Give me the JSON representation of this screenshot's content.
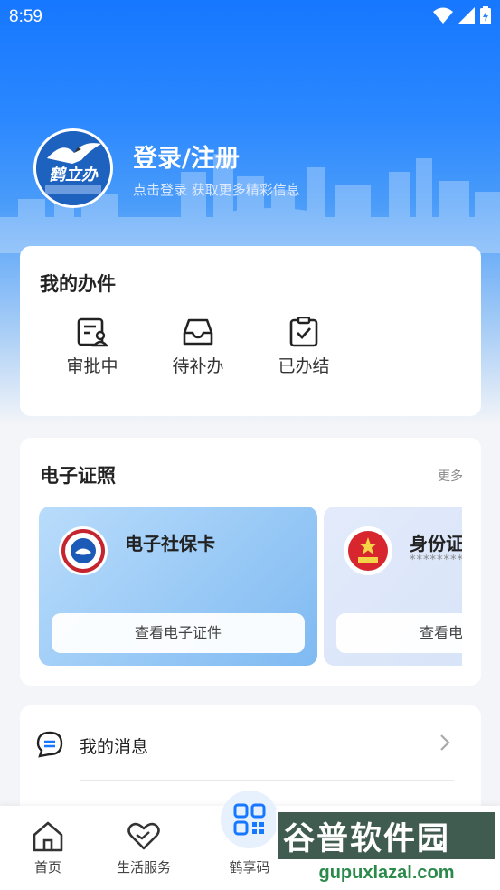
{
  "status_bar": {
    "time": "8:59",
    "icons": [
      "wifi-icon",
      "signal-icon",
      "battery-icon"
    ]
  },
  "profile": {
    "avatar_text": "鹤立办",
    "login_title": "登录/注册",
    "login_subtitle": "点击登录 获取更多精彩信息"
  },
  "my_tasks": {
    "title": "我的办件",
    "items": [
      {
        "label": "审批中",
        "icon": "approval-doc-icon"
      },
      {
        "label": "待补办",
        "icon": "inbox-tray-icon"
      },
      {
        "label": "已办结",
        "icon": "clipboard-check-icon"
      }
    ]
  },
  "certificates": {
    "title": "电子证照",
    "more": "更多",
    "cards": [
      {
        "name": "电子社保卡",
        "masked": "",
        "button": "查看电子证件",
        "icon": "social-security-emblem-icon"
      },
      {
        "name": "身份证",
        "masked": "********",
        "button": "查看电子证件",
        "icon": "national-emblem-icon"
      }
    ]
  },
  "messages": {
    "label": "我的消息",
    "icon": "message-bubble-icon"
  },
  "tab_bar": {
    "tabs": [
      {
        "label": "首页",
        "icon": "home-icon"
      },
      {
        "label": "生活服务",
        "icon": "heart-hands-icon"
      },
      {
        "label": "鹤享码",
        "icon": "qr-code-icon"
      },
      {
        "label": "",
        "icon": ""
      },
      {
        "label": "",
        "icon": ""
      }
    ]
  },
  "watermark": {
    "text": "谷普软件园",
    "url": "gupuxlazal.com"
  },
  "colors": {
    "primary": "#1677ff",
    "card_bg": "#ffffff",
    "page_bg": "#f4f5f8",
    "cert_blue": "#8ec7f5"
  }
}
